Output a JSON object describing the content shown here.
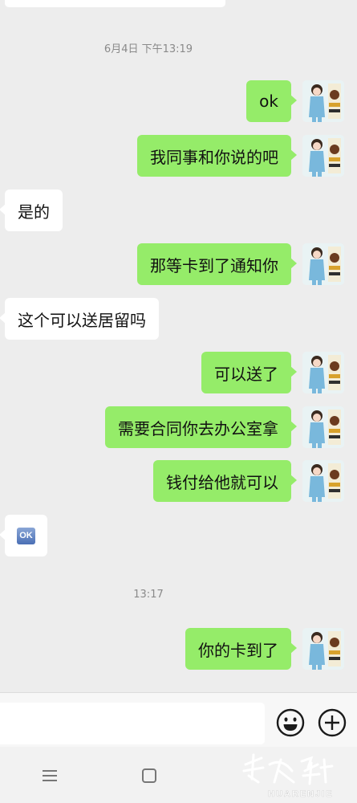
{
  "chat": {
    "timestamps": [
      "6月4日 下午13:19",
      "13:17"
    ],
    "messages": [
      {
        "side": "out",
        "text": "ok"
      },
      {
        "side": "out",
        "text": "我同事和你说的吧"
      },
      {
        "side": "in",
        "text": "是的"
      },
      {
        "side": "out",
        "text": "那等卡到了通知你"
      },
      {
        "side": "in",
        "text": "这个可以送居留吗"
      },
      {
        "side": "out",
        "text": "可以送了"
      },
      {
        "side": "out",
        "text": "需要合同你去办公室拿"
      },
      {
        "side": "out",
        "text": "钱付给他就可以"
      },
      {
        "side": "in",
        "emoji": "ok-button-emoji",
        "text": "OK"
      },
      {
        "side": "out",
        "text": "你的卡到了"
      }
    ]
  },
  "input_bar": {
    "icons": [
      "smiley-icon",
      "plus-circle-icon"
    ]
  },
  "navbar": {
    "icons": [
      "menu-icon",
      "home-square-icon"
    ]
  },
  "watermark": {
    "text": "HUARENJIE"
  },
  "colors": {
    "outgoing_bubble": "#95ec69",
    "incoming_bubble": "#ffffff",
    "background": "#ededed"
  }
}
